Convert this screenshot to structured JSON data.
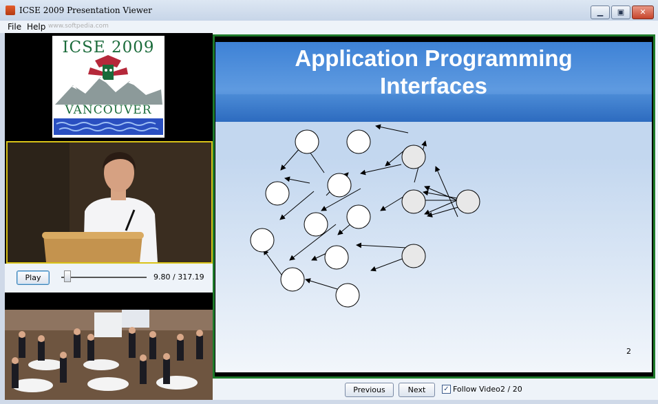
{
  "window": {
    "title": "ICSE 2009 Presentation Viewer",
    "minimize_glyph": "▁",
    "maximize_glyph": "▣",
    "close_glyph": "✕"
  },
  "menu": {
    "items": [
      "File",
      "Help"
    ],
    "watermark": "www.softpedia.com"
  },
  "logo": {
    "top_text": "ICSE 2009",
    "bottom_text": "VANCOUVER"
  },
  "player": {
    "play_label": "Play",
    "time": "9.80 / 317.19",
    "position_seconds": 9.8,
    "duration_seconds": 317.19
  },
  "slide": {
    "title": "Application Programming\nInterfaces",
    "number": "2"
  },
  "navigation": {
    "previous_label": "Previous",
    "next_label": "Next",
    "follow_label": "Follow Video",
    "follow_checked": true,
    "check_glyph": "✓",
    "page": "2 / 20"
  },
  "colors": {
    "video_border": "#d9c318",
    "slide_border": "#1d7a2a",
    "slide_header": "#3e82d6"
  },
  "icons": [
    "java-app-icon",
    "minimize-icon",
    "maximize-icon",
    "close-icon",
    "checkbox-check-icon"
  ]
}
